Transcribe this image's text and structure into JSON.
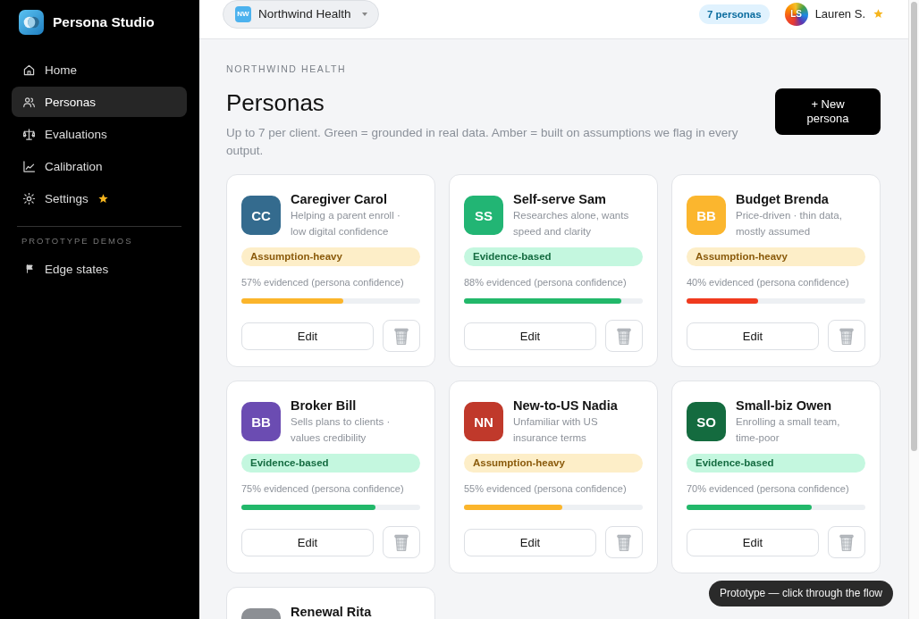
{
  "app": {
    "name": "Persona Studio"
  },
  "sidebar": {
    "items": [
      {
        "kind": "home",
        "label": "Home",
        "selected": false,
        "starred": false
      },
      {
        "kind": "people",
        "label": "Personas",
        "selected": true,
        "starred": false
      },
      {
        "kind": "scale",
        "label": "Evaluations",
        "selected": false,
        "starred": false
      },
      {
        "kind": "chart",
        "label": "Calibration",
        "selected": false,
        "starred": false
      },
      {
        "kind": "sun",
        "label": "Settings",
        "selected": false,
        "starred": true
      }
    ],
    "section": {
      "title": "PROTOTYPE DEMOS",
      "items": [
        {
          "kind": "flag",
          "label": "Edge states",
          "selected": false,
          "starred": false
        }
      ]
    }
  },
  "header": {
    "client": {
      "badge": "NW",
      "name": "Northwind Health"
    },
    "count": "7 personas",
    "user": {
      "initials": "LS",
      "name": "Lauren S.",
      "starred": true
    }
  },
  "page": {
    "eyebrow": "NORTHWIND HEALTH",
    "title": "Personas",
    "description": "Up to 7 per client. Green = grounded in real data. Amber = built on assumptions we flag in every output.",
    "new_button": "+ New persona"
  },
  "personas": [
    {
      "initials": "CC",
      "name": "Caregiver Carol",
      "description": "Helping a parent enroll · low digital confidence",
      "color": "#346b8e",
      "evidence": {
        "kind": "assumption",
        "label": "Assumption-heavy"
      },
      "confidence": "57% evidenced (persona confidence)",
      "level": 0.57,
      "edit": "Edit"
    },
    {
      "initials": "SS",
      "name": "Self-serve Sam",
      "description": "Researches alone, wants speed and clarity",
      "color": "#22b574",
      "evidence": {
        "kind": "evidence",
        "label": "Evidence-based"
      },
      "confidence": "88% evidenced (persona confidence)",
      "level": 0.88,
      "edit": "Edit"
    },
    {
      "initials": "BB",
      "name": "Budget Brenda",
      "description": "Price-driven · thin data, mostly assumed",
      "color": "#fbb62e",
      "evidence": {
        "kind": "assumption",
        "label": "Assumption-heavy"
      },
      "confidence": "40% evidenced (persona confidence)",
      "level": 0.4,
      "edit": "Edit"
    },
    {
      "initials": "BB",
      "name": "Broker Bill",
      "description": "Sells plans to clients · values credibility",
      "color": "#6b4cb2",
      "evidence": {
        "kind": "evidence",
        "label": "Evidence-based"
      },
      "confidence": "75% evidenced (persona confidence)",
      "level": 0.75,
      "edit": "Edit"
    },
    {
      "initials": "NN",
      "name": "New-to-US Nadia",
      "description": "Unfamiliar with US insurance terms",
      "color": "#c0392b",
      "evidence": {
        "kind": "assumption",
        "label": "Assumption-heavy"
      },
      "confidence": "55% evidenced (persona confidence)",
      "level": 0.55,
      "edit": "Edit"
    },
    {
      "initials": "SO",
      "name": "Small-biz Owen",
      "description": "Enrolling a small team, time-poor",
      "color": "#146b3f",
      "evidence": {
        "kind": "evidence",
        "label": "Evidence-based"
      },
      "confidence": "70% evidenced (persona confidence)",
      "level": 0.7,
      "edit": "Edit"
    },
    {
      "name": "Renewal Rita",
      "color": "#8c8f94"
    }
  ],
  "toast": "Prototype — click through the flow"
}
